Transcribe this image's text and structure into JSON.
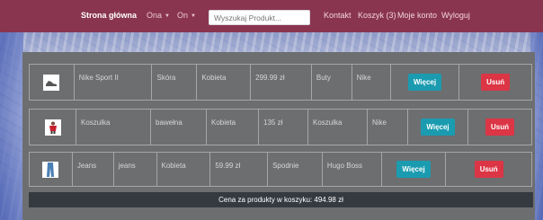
{
  "nav": {
    "brand": "Strona główna",
    "menu_women": "Ona",
    "menu_men": "On",
    "search_placeholder": "Wyszukaj Produkt...",
    "contact": "Kontakt",
    "cart": "Koszyk (3)",
    "account": "Moje konto",
    "logout": "Wyloguj"
  },
  "cart": {
    "more_label": "Więcej",
    "remove_label": "Usuń",
    "items": [
      {
        "name": "Nike Sport II",
        "material": "Skóra",
        "gender": "Kobieta",
        "price": "299.99 zł",
        "category": "Buty",
        "brand": "Nike"
      },
      {
        "name": "Koszulka",
        "material": "bawełna",
        "gender": "Kobieta",
        "price": "135 zł",
        "category": "Koszulka",
        "brand": "Nike"
      },
      {
        "name": "Jeans",
        "material": "jeans",
        "gender": "Kobieta",
        "price": "59.99 zł",
        "category": "Spodnie",
        "brand": "Hugo Boss"
      }
    ],
    "total_text": "Cena za produkty w koszyku: 494.98 zł"
  },
  "colors": {
    "navbar": "#8a3550",
    "panel": "#6d6e70",
    "more_button": "#1a9bb0",
    "remove_button": "#dc3545",
    "total_bar": "#343a40"
  }
}
